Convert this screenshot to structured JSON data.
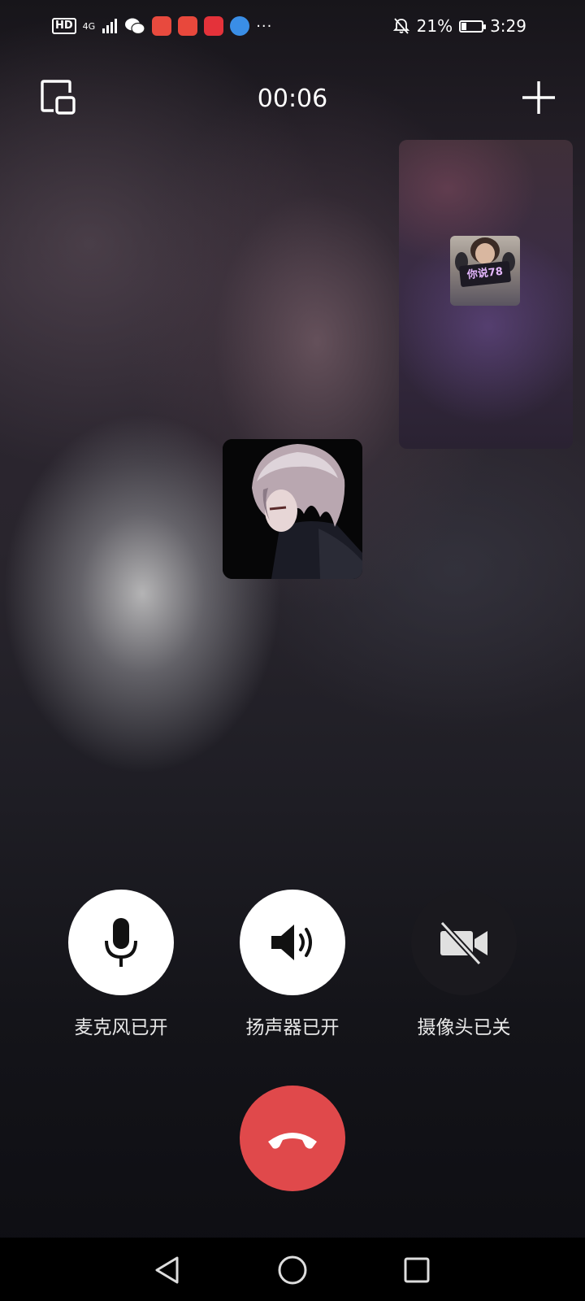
{
  "status_bar": {
    "network_badge": "HD",
    "network_type": "4G",
    "more_indicator": "···",
    "app_icons": [
      {
        "name": "wechat-icon",
        "color": "#ffffff"
      },
      {
        "name": "huawei-store-icon",
        "color": "#e84a3e"
      },
      {
        "name": "reader-icon",
        "color": "#e8483c"
      },
      {
        "name": "video-app-icon",
        "color": "#e4323a"
      },
      {
        "name": "browser-icon",
        "color": "#3a8ee6"
      }
    ],
    "battery_percent": "21%",
    "battery_level": 0.21,
    "time": "3:29"
  },
  "call": {
    "duration": "00:06",
    "minimize_icon": "pip-minimize-icon",
    "add_icon": "plus-icon",
    "remote_video_sign": "你说78"
  },
  "controls": [
    {
      "key": "mic",
      "label": "麦克风已开",
      "icon": "microphone-icon",
      "state": "on"
    },
    {
      "key": "speaker",
      "label": "扬声器已开",
      "icon": "speaker-icon",
      "state": "on"
    },
    {
      "key": "camera",
      "label": "摄像头已关",
      "icon": "camera-off-icon",
      "state": "off"
    }
  ],
  "hangup": {
    "icon": "hang-up-icon",
    "color": "#e0494b"
  },
  "navbar": {
    "items": [
      "back-icon",
      "home-icon",
      "recents-icon"
    ]
  }
}
